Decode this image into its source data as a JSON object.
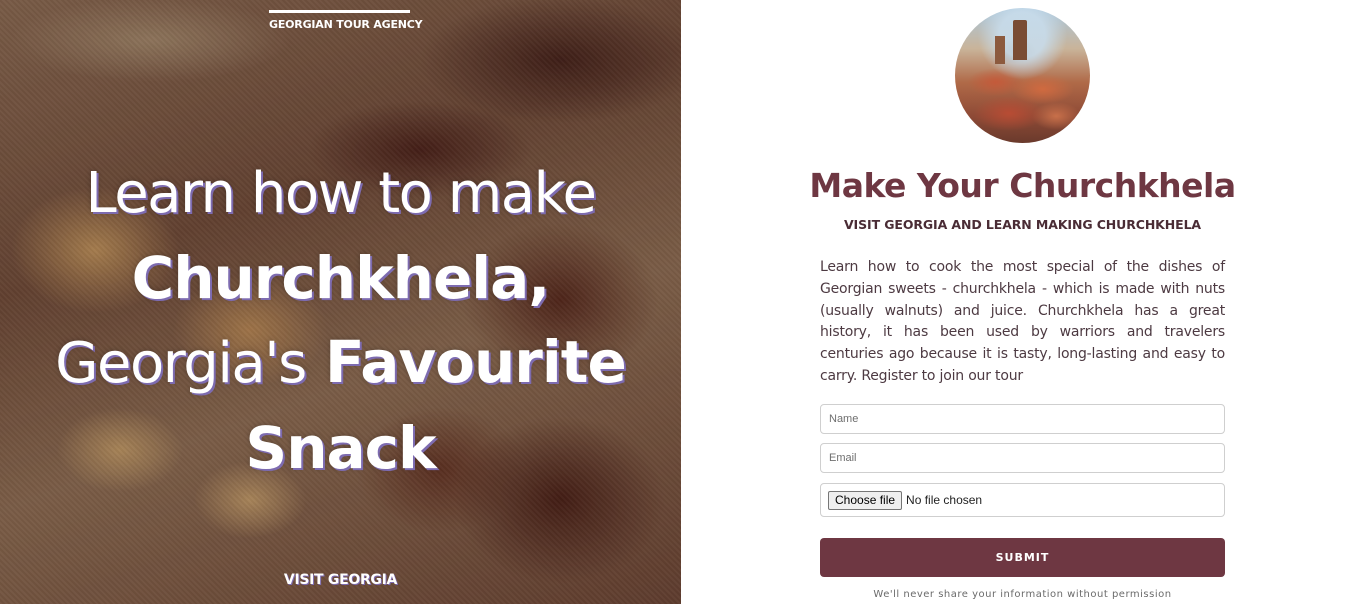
{
  "hero": {
    "brand": "GEORGIAN TOUR AGENCY",
    "headline": {
      "line1": "Learn how to make",
      "line2": "Churchkhela,",
      "line3_light": "Georgia's",
      "line3_bold": "Favourite",
      "line4": "Snack"
    },
    "footer": "VISIT GEORGIA"
  },
  "panel": {
    "title": "Make Your Churchkhela",
    "subtitle": "VISIT GEORGIA AND LEARN MAKING CHURCHKHELA",
    "description": "Learn how to cook the most special of the dishes of Georgian sweets - churchkhela - which is made with nuts (usually walnuts) and juice. Churchkhela has a great history, it has been used by warriors and travelers centuries ago because it is tasty, long-lasting and easy to carry. Register to join our tour",
    "form": {
      "name_placeholder": "Name",
      "email_placeholder": "Email",
      "file_button": "Choose file",
      "file_status": "No file chosen",
      "submit_label": "SUBMIT"
    },
    "privacy_note": "We'll never share your information without permission"
  },
  "colors": {
    "accent": "#6e3742",
    "headline_shadow": "#7d6bb0"
  }
}
